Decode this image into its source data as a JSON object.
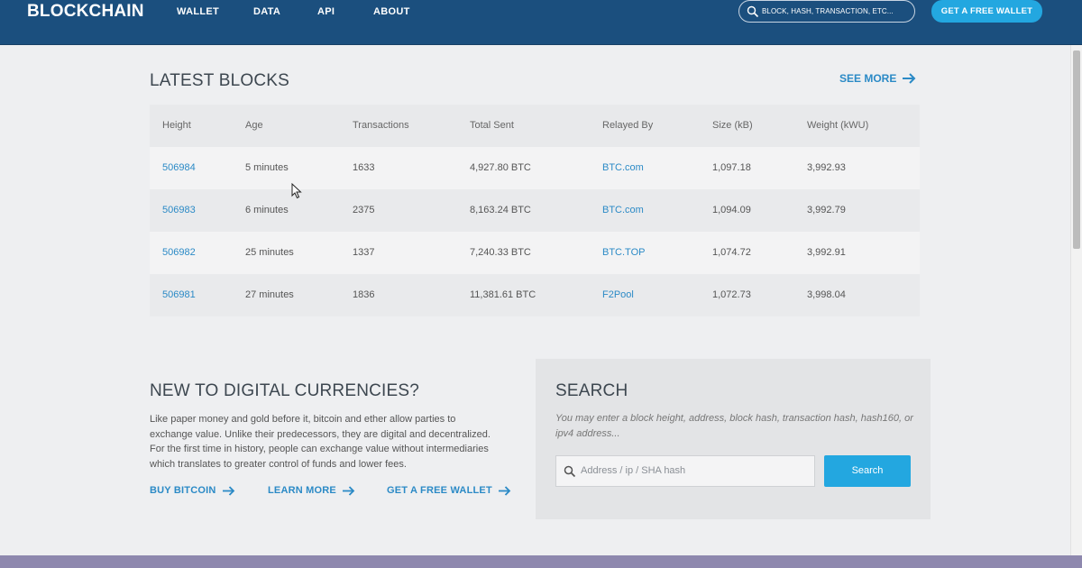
{
  "header": {
    "logo": "BLOCKCHAIN",
    "nav": [
      "WALLET",
      "DATA",
      "API",
      "ABOUT"
    ],
    "search_placeholder": "BLOCK, HASH, TRANSACTION, ETC...",
    "wallet_button": "GET A FREE WALLET",
    "background_color": "#1b4f7e",
    "accent_color": "#23a7e0"
  },
  "latest_blocks": {
    "title": "LATEST BLOCKS",
    "see_more": "SEE MORE",
    "columns": [
      "Height",
      "Age",
      "Transactions",
      "Total Sent",
      "Relayed By",
      "Size (kB)",
      "Weight (kWU)"
    ],
    "rows": [
      {
        "height": "506984",
        "age": "5 minutes",
        "transactions": "1633",
        "total_sent": "4,927.80 BTC",
        "relayed_by": "BTC.com",
        "size": "1,097.18",
        "weight": "3,992.93"
      },
      {
        "height": "506983",
        "age": "6 minutes",
        "transactions": "2375",
        "total_sent": "8,163.24 BTC",
        "relayed_by": "BTC.com",
        "size": "1,094.09",
        "weight": "3,992.79"
      },
      {
        "height": "506982",
        "age": "25 minutes",
        "transactions": "1337",
        "total_sent": "7,240.33 BTC",
        "relayed_by": "BTC.TOP",
        "size": "1,074.72",
        "weight": "3,992.91"
      },
      {
        "height": "506981",
        "age": "27 minutes",
        "transactions": "1836",
        "total_sent": "11,381.61 BTC",
        "relayed_by": "F2Pool",
        "size": "1,072.73",
        "weight": "3,998.04"
      }
    ]
  },
  "intro": {
    "title": "NEW TO DIGITAL CURRENCIES?",
    "body": "Like paper money and gold before it, bitcoin and ether allow parties to exchange value. Unlike their predecessors, they are digital and decentralized. For the first time in history, people can exchange value without intermediaries which translates to greater control of funds and lower fees.",
    "links": [
      "BUY BITCOIN",
      "LEARN MORE",
      "GET A FREE WALLET"
    ]
  },
  "search": {
    "title": "SEARCH",
    "hint": "You may enter a block height, address, block hash, transaction hash, hash160, or ipv4 address...",
    "placeholder": "Address / ip / SHA hash",
    "button": "Search"
  }
}
